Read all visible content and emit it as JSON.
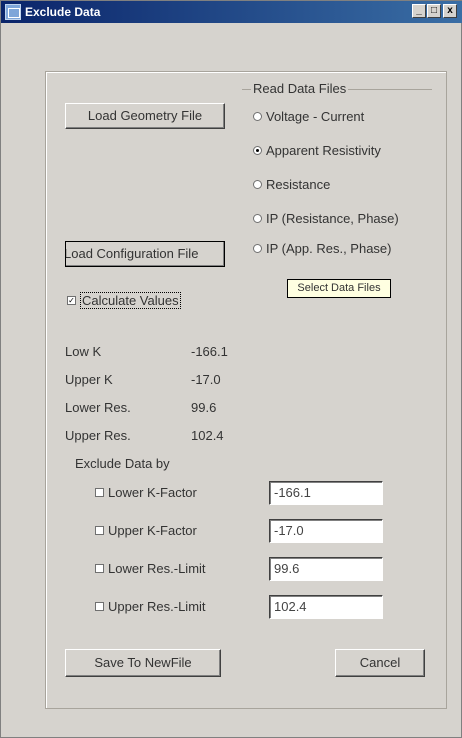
{
  "window": {
    "title": "Exclude Data",
    "min_label": "_",
    "max_label": "□",
    "close_label": "x"
  },
  "buttons": {
    "load_geometry": "Load Geometry File",
    "load_configuration": "Load Configuration File",
    "save": "Save To NewFile",
    "cancel": "Cancel"
  },
  "read_data_files": {
    "title": "Read Data Files",
    "options": [
      {
        "label": "Voltage - Current",
        "selected": false
      },
      {
        "label": "Apparent Resistivity",
        "selected": true
      },
      {
        "label": "Resistance",
        "selected": false
      },
      {
        "label": "IP (Resistance, Phase)",
        "selected": false
      },
      {
        "label": "IP (App. Res., Phase)",
        "selected": false
      }
    ],
    "tooltip": "Select Data Files"
  },
  "calculate_values": {
    "label": "Calculate Values",
    "checked": true
  },
  "stats": [
    {
      "label": "Low K",
      "value": "-166.1"
    },
    {
      "label": "Upper K",
      "value": "-17.0"
    },
    {
      "label": "Lower Res.",
      "value": "99.6"
    },
    {
      "label": "Upper Res.",
      "value": "102.4"
    }
  ],
  "exclude": {
    "title": "Exclude Data by",
    "rows": [
      {
        "label": "Lower K-Factor",
        "checked": false,
        "value": "-166.1"
      },
      {
        "label": "Upper K-Factor",
        "checked": false,
        "value": "-17.0"
      },
      {
        "label": "Lower Res.-Limit",
        "checked": false,
        "value": "99.6"
      },
      {
        "label": "Upper Res.-Limit",
        "checked": false,
        "value": "102.4"
      }
    ]
  }
}
